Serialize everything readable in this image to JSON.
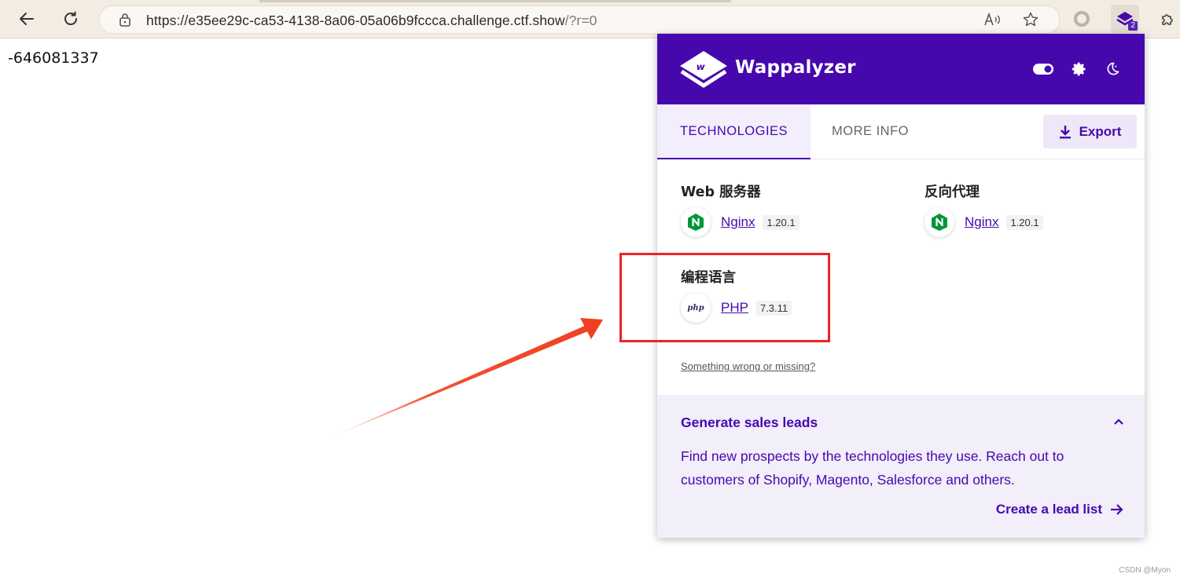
{
  "browser": {
    "url_main": "https://e35ee29c-ca53-4138-8a06-05a06b9fccca.challenge.ctf.show",
    "url_query": "/?r=0",
    "extension_badge": "2"
  },
  "page": {
    "number": "-646081337"
  },
  "wappalyzer": {
    "brand": "Wappalyzer",
    "tabs": [
      "TECHNOLOGIES",
      "MORE INFO"
    ],
    "export_label": "Export",
    "categories": [
      {
        "title": "Web 服务器",
        "tech": "Nginx",
        "version": "1.20.1",
        "icon": "nginx-icon"
      },
      {
        "title": "反向代理",
        "tech": "Nginx",
        "version": "1.20.1",
        "icon": "nginx-icon"
      },
      {
        "title": "编程语言",
        "tech": "PHP",
        "version": "7.3.11",
        "icon": "php-icon",
        "icon_text": "php"
      }
    ],
    "missing_link": "Something wrong or missing?",
    "leads": {
      "title": "Generate sales leads",
      "body": "Find new prospects by the technologies they use. Reach out to customers of Shopify, Magento, Salesforce and others.",
      "cta": "Create a lead list"
    },
    "accent_color": "#4608ad"
  },
  "annotation": {
    "box_color": "#ee2222",
    "arrow_color": "#f04020"
  },
  "watermark": "CSDN @Myon⁠"
}
